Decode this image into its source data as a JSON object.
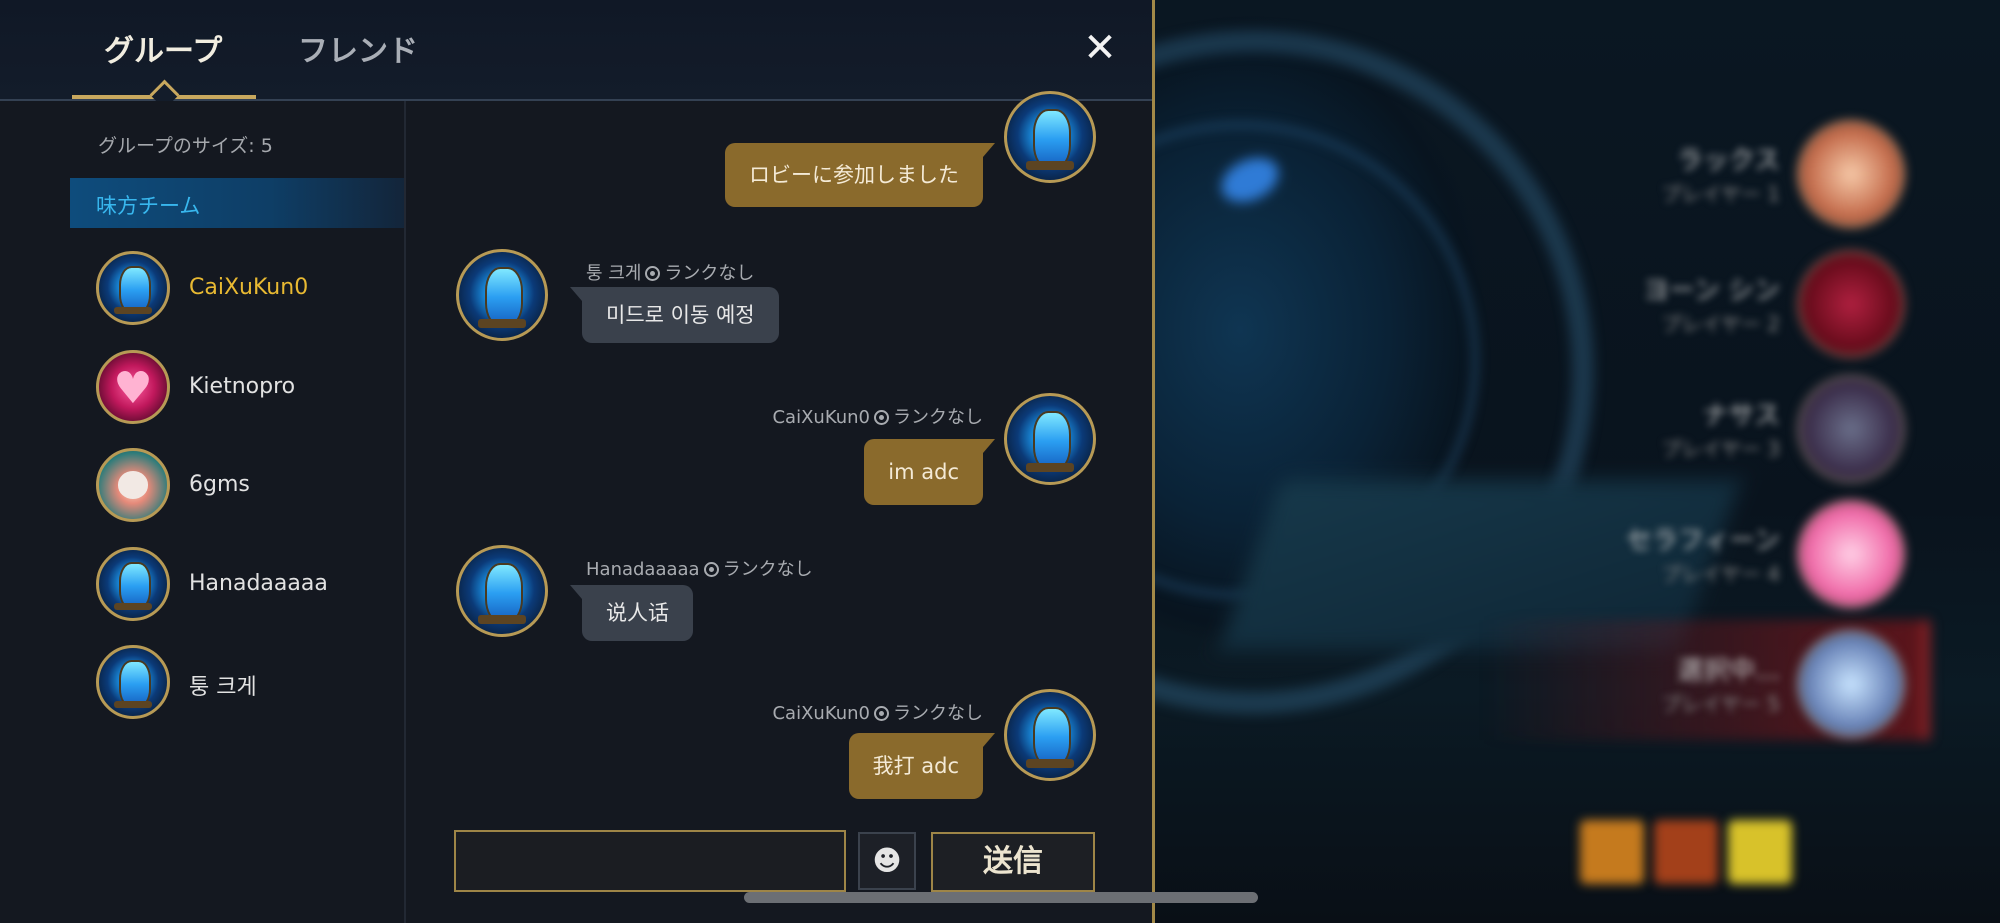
{
  "tabs": {
    "group": "グループ",
    "friends": "フレンド",
    "close": "✕"
  },
  "sidebar": {
    "group_size": "グループのサイズ: 5",
    "team_label": "味方チーム",
    "members": [
      {
        "name": "CaiXuKun0",
        "is_self": true,
        "avatar": "crystal"
      },
      {
        "name": "Kietnopro",
        "is_self": false,
        "avatar": "heart"
      },
      {
        "name": "6gms",
        "is_self": false,
        "avatar": "poro"
      },
      {
        "name": "Hanadaaaaa",
        "is_self": false,
        "avatar": "crystal"
      },
      {
        "name": "퉁 크게",
        "is_self": false,
        "avatar": "crystal"
      }
    ]
  },
  "chat": {
    "messages": [
      {
        "direction": "out",
        "sender": "",
        "rank": "",
        "text": "ロビーに参加しました"
      },
      {
        "direction": "in",
        "sender": "퉁 크게",
        "rank": "ランクなし",
        "text": "미드로 이동 예정"
      },
      {
        "direction": "out",
        "sender": "CaiXuKun0",
        "rank": "ランクなし",
        "text": "im adc"
      },
      {
        "direction": "in",
        "sender": "Hanadaaaaa",
        "rank": "ランクなし",
        "text": "说人话"
      },
      {
        "direction": "out",
        "sender": "CaiXuKun0",
        "rank": "ランクなし",
        "text": "我打 adc"
      }
    ]
  },
  "input": {
    "value": "",
    "placeholder": "",
    "emoji_icon": "☻",
    "send_label": "送信"
  },
  "background_roster": [
    {
      "name": "ラックス",
      "sub": "プレイヤー 1"
    },
    {
      "name": "ヨーン シン",
      "sub": "プレイヤー 2"
    },
    {
      "name": "ナサス",
      "sub": "プレイヤー 3"
    },
    {
      "name": "セラフィーン",
      "sub": "プレイヤー 4"
    },
    {
      "name": "選択中...",
      "sub": "プレイヤー 5"
    }
  ],
  "colors": {
    "accent_gold": "#c8a85e",
    "self_name": "#e8b932",
    "team_header_text": "#38b7ee",
    "bubble_out": "#8a6a2c",
    "bubble_in": "#3a414c"
  }
}
